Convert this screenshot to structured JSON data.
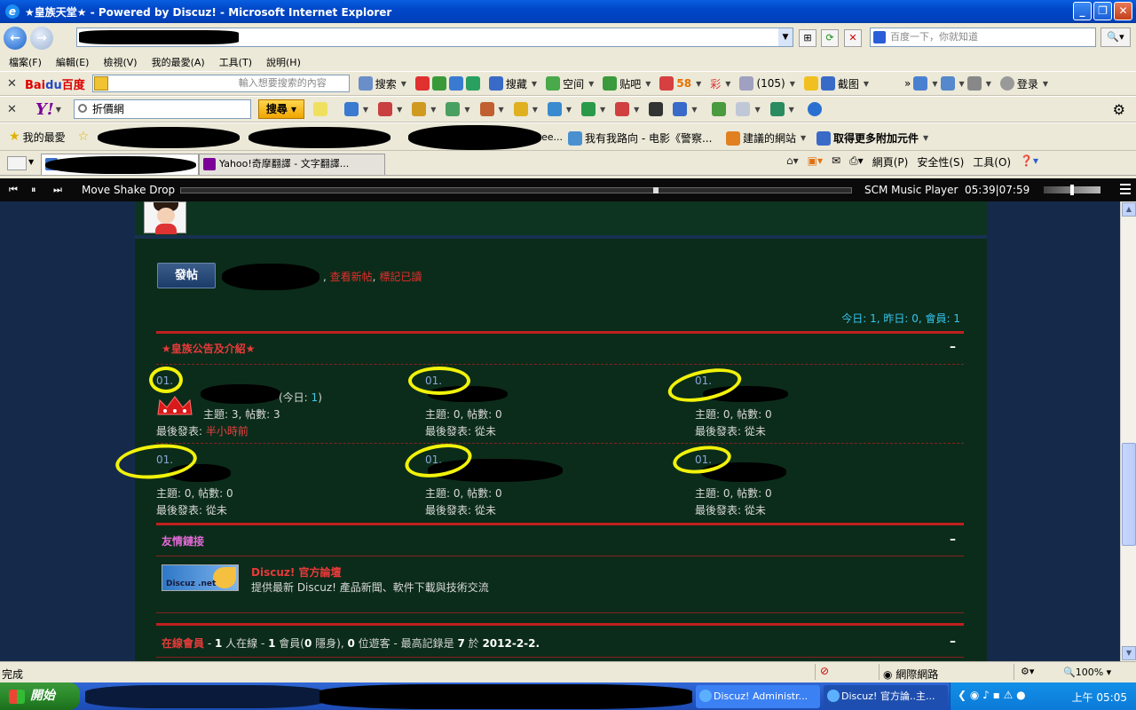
{
  "window": {
    "title": "★皇族天堂★ - Powered by Discuz! - Microsoft Internet Explorer",
    "buttons": [
      "_",
      "❐",
      "✕"
    ]
  },
  "address_bar": {
    "url": "",
    "search_placeholder": "百度一下，你就知道"
  },
  "menu": [
    "檔案(F)",
    "編輯(E)",
    "檢視(V)",
    "我的最愛(A)",
    "工具(T)",
    "說明(H)"
  ],
  "baidu_toolbar": {
    "logo_a": "Bai",
    "logo_b": "du",
    "logo_c": "百度",
    "input_placeholder": "輸入想要搜索的內容",
    "items": [
      "搜索",
      "搜藏",
      "空间",
      "贴吧",
      "58",
      "彩",
      "(105)",
      "截图",
      "登录"
    ]
  },
  "yahoo_toolbar": {
    "logo": "Y!",
    "input_value": "折價網",
    "search_button": "搜尋"
  },
  "favorites_bar": {
    "favorites_label": "我的最愛",
    "items": [
      "我有我路向 - 电影《警察...",
      "建議的網站",
      "取得更多附加元件"
    ],
    "truncated": "ee..."
  },
  "tabs": [
    {
      "label": ""
    },
    {
      "label": "Yahoo!奇摩翻譯 - 文字翻譯..."
    }
  ],
  "command_bar": [
    "網頁(P)",
    "安全性(S)",
    "工具(O)"
  ],
  "player": {
    "song": "Move Shake Drop",
    "name": "SCM Music Player",
    "time": "05:39|07:59",
    "progress": 0.71
  },
  "page": {
    "post_button": "發帖",
    "new_posts": "查看新帖",
    "mark_read": "標記已讀",
    "sep": ",",
    "stats": "今日: 1, 昨日: 0, 會員: 1",
    "section1_title": "★皇族公告及介紹★",
    "collapse": "–",
    "forums": [
      {
        "num": "01.",
        "today": "(今日: ",
        "today_count": "1",
        "today_close": ")",
        "meta": "主題: 3, 帖數: 3",
        "last_label": "最後發表: ",
        "last": "半小時前"
      },
      {
        "num": "01.",
        "meta": "主題: 0, 帖數: 0",
        "last_label": "最後發表: ",
        "last": "從未"
      },
      {
        "num": "01.",
        "meta": "主題: 0, 帖數: 0",
        "last_label": "最後發表: ",
        "last": "從未"
      },
      {
        "num": "01.",
        "meta": "主題: 0, 帖數: 0",
        "last_label": "最後發表: ",
        "last": "從未"
      },
      {
        "num": "01.",
        "meta": "主題: 0, 帖數: 0",
        "last_label": "最後發表: ",
        "last": "從未"
      },
      {
        "num": "01.",
        "meta": "主題: 0, 帖數: 0",
        "last_label": "最後發表: ",
        "last": "從未"
      }
    ],
    "friend_links_title": "友情鏈接",
    "dz_logo_text": "Discuz .net",
    "dz_title": "Discuz! 官方論壇",
    "dz_desc": "提供最新 Discuz! 產品新聞、軟件下載與技術交流",
    "online": {
      "title": "在線會員",
      "dash": " - ",
      "n1": "1",
      "t1": " 人在線 - ",
      "n2": "1",
      "t2": " 會員(",
      "n3": "0",
      "t3": " 隱身), ",
      "n4": "0",
      "t4": " 位遊客 - 最高記錄是 ",
      "n5": "7",
      "t5": " 於 ",
      "date": "2012-2-2",
      "end": "."
    }
  },
  "status_bar": {
    "text": "完成",
    "zone": "網際網路",
    "zoom": "100%"
  },
  "taskbar": {
    "start": "開始",
    "items": [
      "Discuz! Administr...",
      "Discuz! 官方論..主..."
    ],
    "clock": "上午 05:05"
  }
}
